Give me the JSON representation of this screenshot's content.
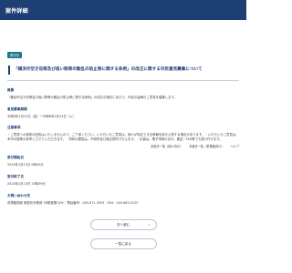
{
  "header": {
    "title": "案件詳細"
  },
  "badge": "受付中",
  "title": "「横浜市空き缶等及び吸い殻等の散乱の防止等に関する条例」の改正に関する市民意見募集について",
  "sections": [
    {
      "label": "概要",
      "value": "「横浜市空き缶等及び吸い殻等の散乱の防止等に関する条例」の改正の検討にあたり、市民の皆様のご意見を募集します。"
    },
    {
      "label": "意見募集期間",
      "value": "令和6年1月12日（金）～令和6年2月13日（火）"
    },
    {
      "label": "注意事項",
      "value": "・ご意見への個別の回答はいたしませんので、ご了承ください。いただいたご意見は、個人が特定できる情報を除き公表する場合があります。・いただいたご意見は、本市の施策の参考とさせていただきます。・資料の閲覧は、市役所及び各区役所で行えます。・応募は、電子申請のほか、郵送・FAX等でも受け付けます。"
    }
  ],
  "files": [
    "手続き一覧（個人向け）",
    "手続き一覧（事業者向け）",
    "ヘルプ"
  ],
  "sections2": [
    {
      "label": "受付開始日",
      "value": "2024年1月12日 0時00分"
    },
    {
      "label": "受付終了日",
      "value": "2024年2月13日 23時59分"
    },
    {
      "label": "お問い合わせ先",
      "value": "資源循環局 家庭系対策部 3R推進課 ほか｜電話番号：045-671-3593｜FAX：045-663-0125"
    }
  ],
  "buttons": {
    "next": "次へ進む",
    "back": "一覧に戻る"
  }
}
